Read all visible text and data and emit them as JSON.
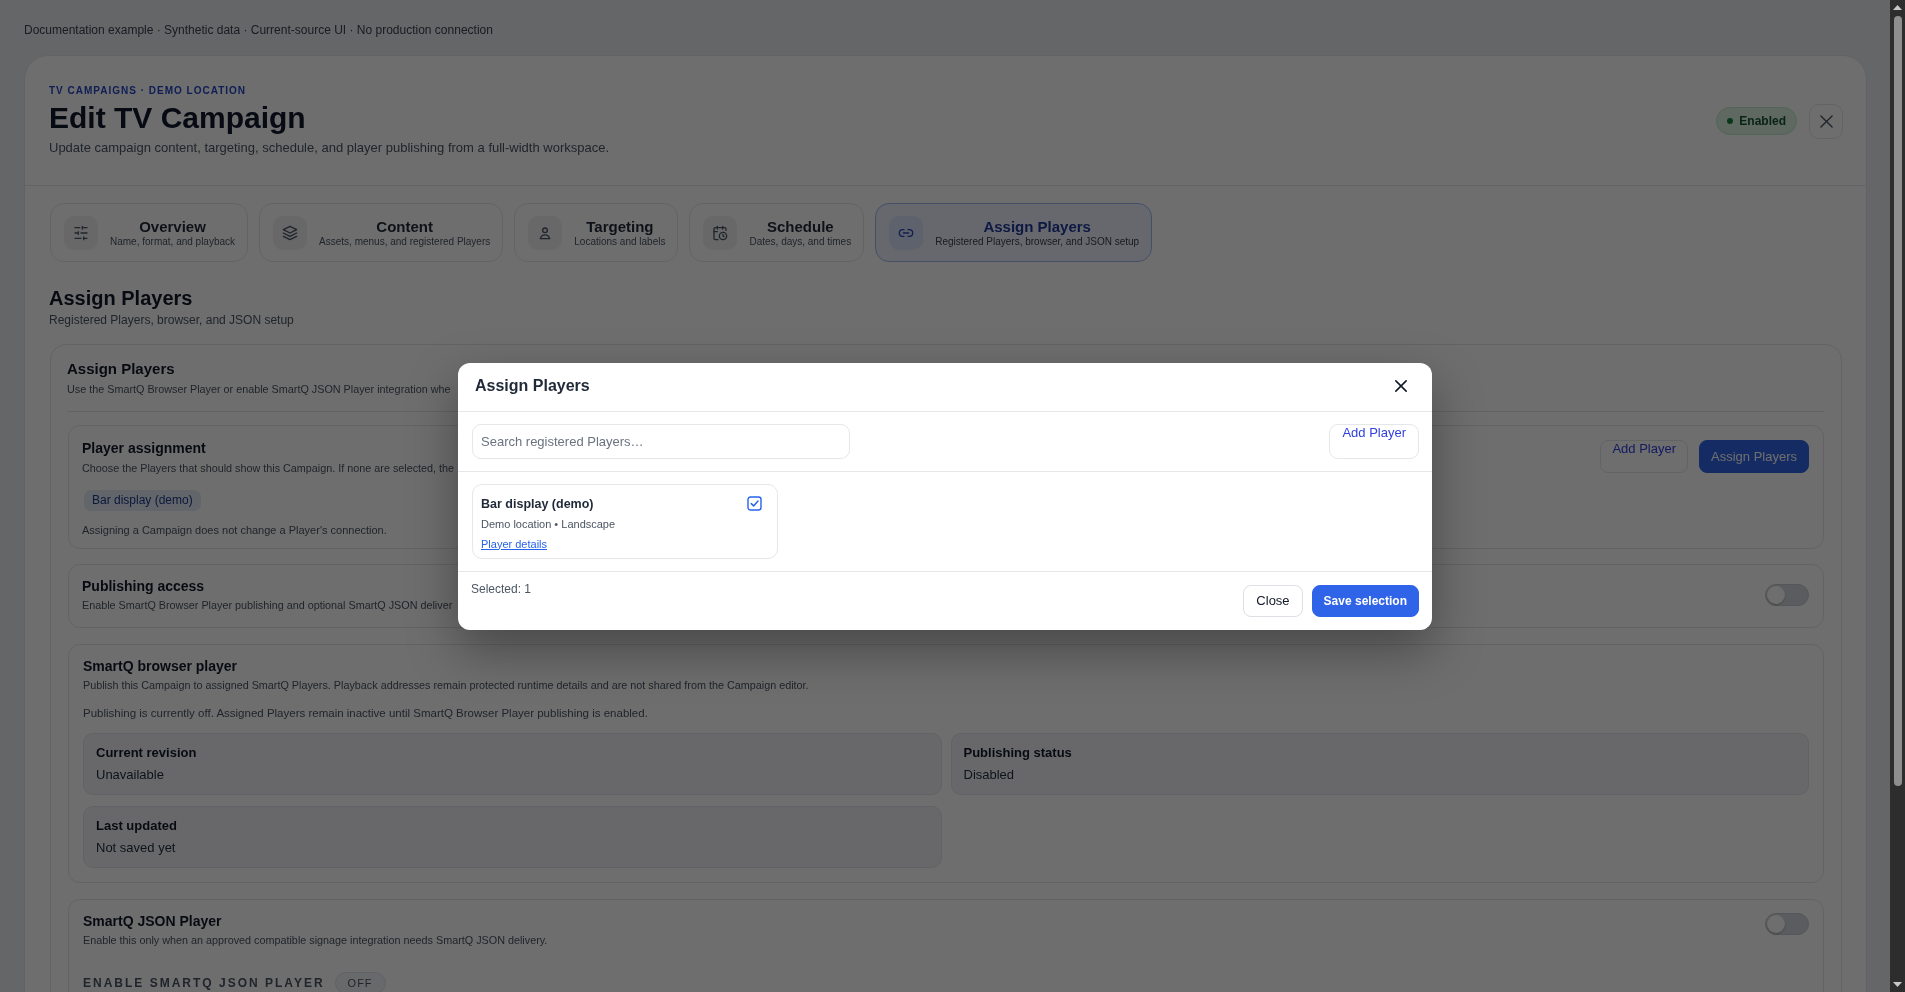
{
  "banner": "Documentation example · Synthetic data · Current-source UI · No production connection",
  "header": {
    "eyebrow": "TV CAMPAIGNS · DEMO LOCATION",
    "title": "Edit TV Campaign",
    "subtitle": "Update campaign content, targeting, schedule, and player publishing from a full-width workspace.",
    "status": "Enabled"
  },
  "tabs": [
    {
      "title": "Overview",
      "subtitle": "Name, format, and playback",
      "selected": false
    },
    {
      "title": "Content",
      "subtitle": "Assets, menus, and registered Players",
      "selected": false
    },
    {
      "title": "Targeting",
      "subtitle": "Locations and labels",
      "selected": false
    },
    {
      "title": "Schedule",
      "subtitle": "Dates, days, and times",
      "selected": false
    },
    {
      "title": "Assign Players",
      "subtitle": "Registered Players, browser, and JSON setup",
      "selected": true
    }
  ],
  "section": {
    "title": "Assign Players",
    "subtitle": "Registered Players, browser, and JSON setup"
  },
  "panel": {
    "title": "Assign Players",
    "description": "Use the SmartQ Browser Player or enable SmartQ JSON Player integration whe",
    "player_assignment": {
      "title": "Player assignment",
      "description": "Choose the Players that should show this Campaign. If none are selected, the",
      "chips": [
        "Bar display (demo)"
      ],
      "note": "Assigning a Campaign does not change a Player's connection.",
      "buttons": [
        {
          "label": "Add Player",
          "kind": "link"
        },
        {
          "label": "Assign Players",
          "kind": "primary"
        }
      ]
    },
    "publishing_access": {
      "title": "Publishing access",
      "description": "Enable SmartQ Browser Player publishing and optional SmartQ JSON deliver",
      "on": false
    },
    "browser_player": {
      "title": "SmartQ browser player",
      "description": "Publish this Campaign to assigned SmartQ Players. Playback addresses remain protected runtime details and are not shared from the Campaign editor.",
      "status_text": "Publishing is currently off. Assigned Players remain inactive until SmartQ Browser Player publishing is enabled.",
      "fields": [
        {
          "label": "Current revision",
          "value": "Unavailable"
        },
        {
          "label": "Publishing status",
          "value": "Disabled"
        },
        {
          "label": "Last updated",
          "value": "Not saved yet"
        }
      ]
    },
    "json_player": {
      "title": "SmartQ JSON Player",
      "description": "Enable this only when an approved compatible signage integration needs SmartQ JSON delivery.",
      "on": false,
      "field_label": "ENABLE SMARTQ JSON PLAYER",
      "badge": "OFF"
    }
  },
  "dialog": {
    "title": "Assign Players",
    "search": {
      "placeholder": "Search registered Players…"
    },
    "add_button": {
      "label": "Add Player",
      "kind": "link"
    },
    "players": [
      {
        "name": "Bar display (demo)",
        "meta": "Demo location • Landscape",
        "link": "Player details",
        "checked": true
      }
    ],
    "selected_count": "Selected: 1",
    "buttons": [
      {
        "label": "Close",
        "kind": "secondary"
      },
      {
        "label": "Save selection",
        "kind": "primary"
      }
    ]
  }
}
